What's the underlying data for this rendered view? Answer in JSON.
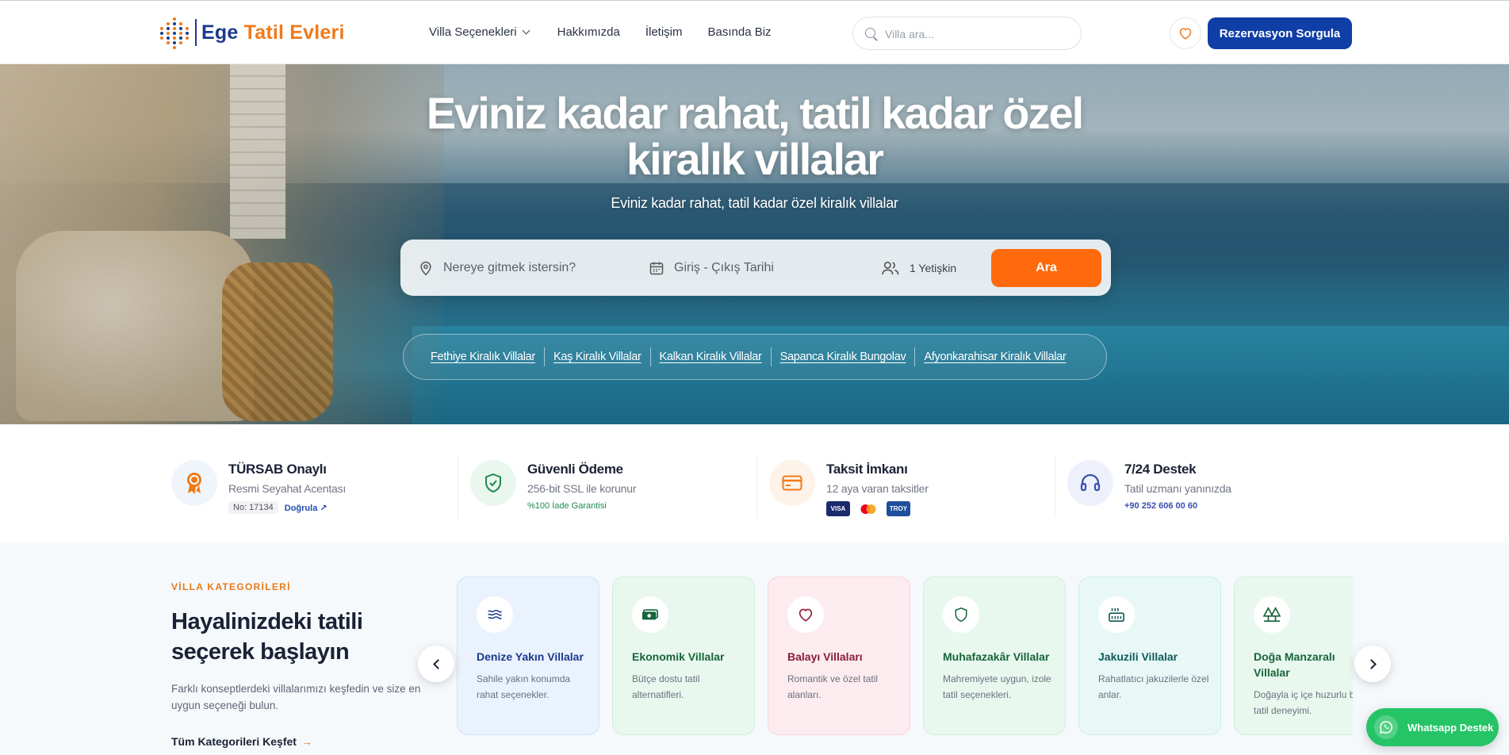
{
  "header": {
    "logo_part1": "Ege",
    "logo_part2": "Tatil Evleri",
    "nav": [
      "Villa Seçenekleri",
      "Hakkımızda",
      "İletişim",
      "Basında Biz"
    ],
    "search_placeholder": "Villa ara...",
    "favorites_icon": "heart-icon",
    "reservation_button": "Rezervasyon Sorgula"
  },
  "hero": {
    "title_line1": "Eviniz kadar rahat, tatil kadar özel",
    "title_line2": "kiralık villalar",
    "subtitle": "Eviniz kadar rahat, tatil kadar özel kiralık villalar",
    "booking": {
      "where_placeholder": "Nereye gitmek istersin?",
      "date_placeholder": "Giriş - Çıkış Tarihi",
      "guests": "1 Yetişkin",
      "search_button": "Ara"
    },
    "quick_links": [
      "Fethiye Kiralık Villalar",
      "Kaş Kiralık Villalar",
      "Kalkan Kiralık Villalar",
      "Sapanca Kiralık Bungolav",
      "Afyonkarahisar Kiralık Villalar"
    ]
  },
  "trust": [
    {
      "title": "TÜRSAB Onaylı",
      "subtitle": "Resmi Seyahat Acentası",
      "badge": "No: 17134",
      "link": "Doğrula"
    },
    {
      "title": "Güvenli Ödeme",
      "subtitle": "256-bit SSL ile korunur",
      "extra": "%100 İade Garantisi"
    },
    {
      "title": "Taksit İmkanı",
      "subtitle": "12 aya varan taksitler",
      "cards": [
        "VISA",
        "MC",
        "TROY"
      ]
    },
    {
      "title": "7/24 Destek",
      "subtitle": "Tatil uzmanı yanınızda",
      "extra": "+90 252 606 00 60"
    }
  ],
  "categories": {
    "eyebrow": "VİLLA KATEGORİLERİ",
    "title": "Hayalinizdeki tatili seçerek başlayın",
    "description": "Farklı konseptlerdeki villalarımızı keşfedin ve size en uygun seçeneği bulun.",
    "link": "Tüm Kategorileri Keşfet",
    "link_arrow": "→",
    "items": [
      {
        "title": "Denize Yakın Villalar",
        "desc": "Sahile yakın konumda rahat seçenekler.",
        "color": "#1b3a8c",
        "bg": "#eaf2fd",
        "border": "#cfe0f8",
        "icon": "waves-icon"
      },
      {
        "title": "Ekonomik Villalar",
        "desc": "Bütçe dostu tatil alternatifleri.",
        "color": "#17643a",
        "bg": "#e9f8ef",
        "border": "#cdeedb",
        "icon": "money-icon"
      },
      {
        "title": "Balayı Villaları",
        "desc": "Romantik ve özel tatil alanları.",
        "color": "#8a1d3a",
        "bg": "#fdecef",
        "border": "#f8d2da",
        "icon": "heart-icon"
      },
      {
        "title": "Muhafazakâr Villalar",
        "desc": "Mahremiyete uygun, izole tatil seçenekleri.",
        "color": "#17643a",
        "bg": "#e9f8ef",
        "border": "#cdeedb",
        "icon": "shield-icon"
      },
      {
        "title": "Jakuzili Villalar",
        "desc": "Rahatlatıcı jakuzilerle özel anlar.",
        "color": "#0f5a5a",
        "bg": "#e8f8f7",
        "border": "#c9eeec",
        "icon": "jacuzzi-icon"
      },
      {
        "title": "Doğa Manzaralı Villalar",
        "desc": "Doğayla iç içe huzurlu bir tatil deneyimi.",
        "color": "#17643a",
        "bg": "#e9f8ef",
        "border": "#cdeedb",
        "icon": "tree-icon"
      }
    ]
  },
  "whatsapp": "Whatsapp Destek"
}
